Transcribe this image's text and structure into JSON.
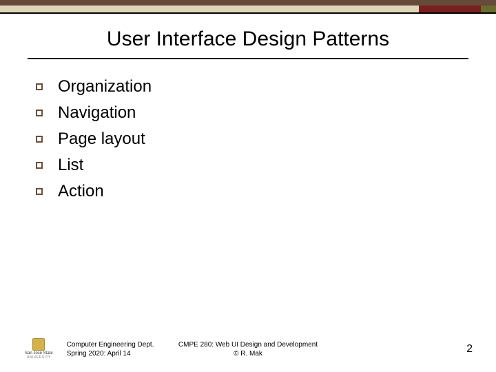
{
  "title": "User Interface Design Patterns",
  "bulletGlyph": "square-outline",
  "items": [
    "Organization",
    "Navigation",
    "Page layout",
    "List",
    "Action"
  ],
  "footer": {
    "logoName": "San José State",
    "logoSub": "UNIVERSITY",
    "leftLine1": "Computer Engineering Dept.",
    "leftLine2": "Spring 2020: April 14",
    "centerLine1": "CMPE 280: Web UI Design and Development",
    "centerLine2": "© R. Mak"
  },
  "pageNumber": "2"
}
